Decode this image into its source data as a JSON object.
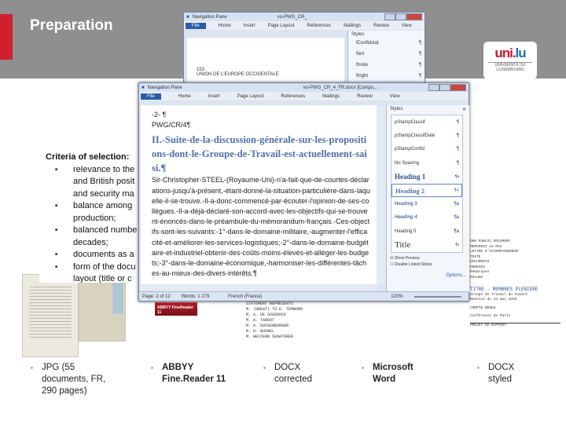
{
  "slide": {
    "title": "Preparation"
  },
  "logo": {
    "text_a": "uni.",
    "text_b": "lu",
    "subtitle": "UNIVERSITÉ DU LUXEMBOURG"
  },
  "back_window": {
    "title": "vo-PWG_CR_",
    "nav": "Navigation Pane",
    "tabs": [
      "File",
      "Home",
      "Insert",
      "Page Layout",
      "References",
      "Mailings",
      "Review",
      "View"
    ],
    "styles_header": "Styles",
    "styles": [
      "fConfidstat",
      "ftert",
      "ftnote",
      "ftright"
    ],
    "doc_lines": [
      "153",
      "UNION DE L'EUROPE OCCIDENTALE"
    ]
  },
  "criteria": {
    "heading": "Criteria of selection:",
    "items": [
      "relevance to the French and British positions on defence and security matters;",
      "balance among documents production;",
      "balanced number of documents over decades;",
      "documents as a",
      "form of the document layout (title or c"
    ]
  },
  "criteria_visible": [
    "relevance to the",
    "and British posit",
    "and security ma",
    "balance among",
    "production;",
    "balanced numbe",
    "decades;",
    "documents as a",
    "form of the docu",
    "layout (title or c"
  ],
  "main_window": {
    "title": "vo-PWG_CR_4_FR.docx [Comps...",
    "nav": "Navigation Pane",
    "tabs": [
      "File",
      "Home",
      "Insert",
      "Page Layout",
      "References",
      "Mailings",
      "Review",
      "View"
    ],
    "doc": {
      "page_no": "-2- ¶",
      "ref": "PWG/CR/4¶",
      "heading": "II.-Suite-de-la-discussion-générale-sur-les-propositions-dont-le-Groupe-de-Travail-est-actuellement-saisi.¶",
      "body": "Sir-Christopher-STEEL-(Royaume-Uni)-n'a-fait-que-de-courtes-déclarations-jusqu'à-présent,-étant-donné-la-situation-particulière-dans-laquelle-il-se-trouve.-Il-a-donc-commencé-par-écouter-l'opinion-de-ses-collègues.-Il-a-déjà-déclaré-son-accord-avec-les-objectifs-qui-se-trouvent-énoncés-dans-le-préambule-du-mémorandum-français.-Ces-objectifs-sont-les-suivants:-1°-dans-le-domaine-militaire,-augmenter-l'efficacité-et-améliorer-les-services-logistiques;-2°-dans-le-domaine-budgétaire-et-industriel-obtenir-des-coûts-moins-élevés-et-alléger-les-budgets;-3°-dans-le-domaine-économique,-harmoniser-les-différentes-tâches-au-mieux-des-divers-intérêts.¶"
    },
    "styles_header": "Styles",
    "styles": [
      "pStampClassif",
      "pStampClassifDate",
      "pStampConfid",
      "No Spacing",
      "Heading 1",
      "Heading 2",
      "Heading 3",
      "Heading 4",
      "Heading 5",
      "Title"
    ],
    "selected_style": "Heading 2",
    "show_preview": "Show Preview",
    "show_preview_checked": true,
    "disable_linked": "Disable Linked Styles",
    "disable_linked_checked": false,
    "options": "Options...",
    "status": {
      "page": "Page: 2 of 12",
      "words": "Words: 1 279",
      "language": "French (France)",
      "zoom": "120%"
    }
  },
  "abbyy_badge": "ABBYY FineReader 11",
  "bottom_snippet": [
    "STATEMENT REPRESENTS",
    "M. (GREAT) TO   E. TEMBORD",
    "M. A. DE SOUSDOCK",
    "M. A. TARDOT",
    "M. A. DUSSENBURGER",
    "M. H. BUSNEL",
    "M. WESTERN SENATOREN"
  ],
  "right_snippet": [
    "ONU PUBLIC DOCUMENT",
    "MERCREDI 18 MAI",
    "LETTRE D'ACCOMPAGNEMENT",
    "TEXTE",
    "DOCUMENTS",
    "ANNEXES",
    "Remarques",
    "Résumé",
    "TITRE - MEMBRES PLENIERE",
    "Groupe de Travail du Comité",
    "Réunion du 24 mai 1955",
    "COMPTE RENDU",
    "Conférence de Paris",
    "PROJET DE RAPPORT"
  ],
  "captions": [
    {
      "text": "JPG (55 documents, FR, 290 pages)",
      "bold": false
    },
    {
      "text": "ABBYY Fine.Reader 11",
      "bold": true
    },
    {
      "text": "DOCX corrected",
      "bold": false
    },
    {
      "text": "Microsoft Word",
      "bold": true
    },
    {
      "text": "DOCX styled",
      "bold": false
    }
  ],
  "colors": {
    "accent_red": "#d0202e",
    "band_grey": "#8f8f8f",
    "heading_blue": "#4f6fa8"
  }
}
